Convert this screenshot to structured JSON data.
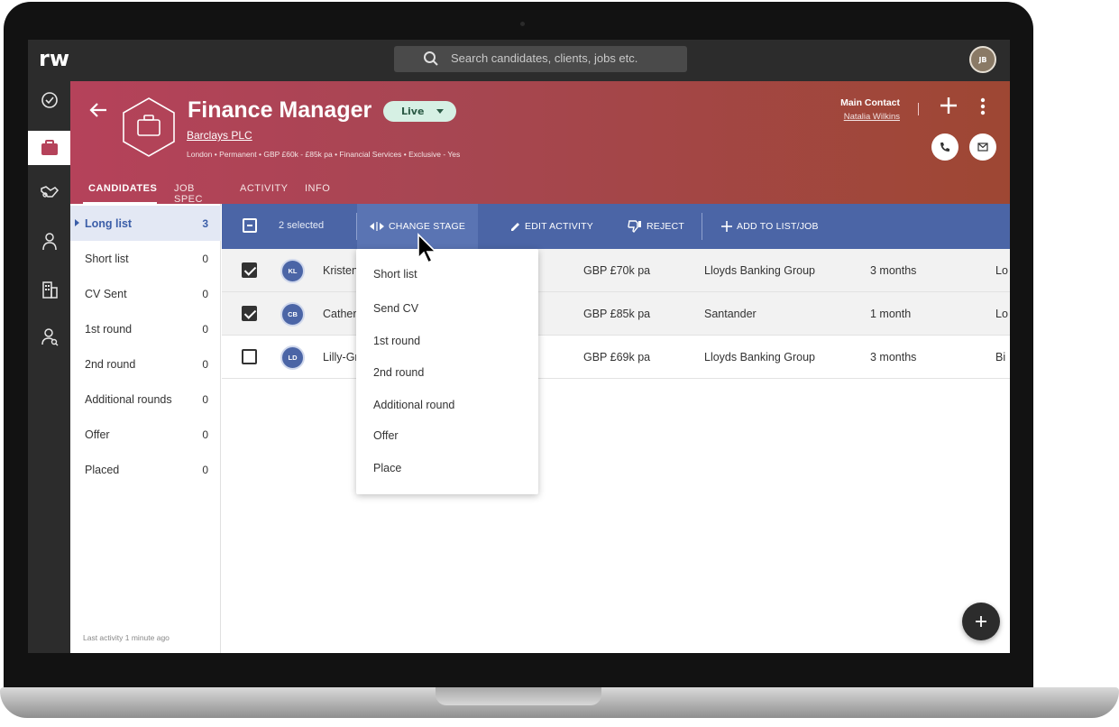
{
  "app": {
    "logo": "rw",
    "user_initials": "JB"
  },
  "search": {
    "placeholder": "Search candidates, clients, jobs etc."
  },
  "rail": {
    "icons": [
      "check-circle-icon",
      "briefcase-icon",
      "handshake-icon",
      "candidate-icon",
      "building-icon",
      "contact-search-icon"
    ],
    "active_index": 1
  },
  "job": {
    "title": "Finance Manager",
    "status": "Live",
    "company": "Barclays PLC",
    "meta": "London • Permanent • GBP £60k - £85k pa • Financial Services • Exclusive - Yes",
    "main_contact_label": "Main Contact",
    "main_contact_name": "Natalia Wilkins"
  },
  "tabs": [
    "CANDIDATES",
    "JOB SPEC",
    "ACTIVITY",
    "INFO"
  ],
  "stages": [
    {
      "label": "Long list",
      "count": "3"
    },
    {
      "label": "Short list",
      "count": "0"
    },
    {
      "label": "CV Sent",
      "count": "0"
    },
    {
      "label": "1st round",
      "count": "0"
    },
    {
      "label": "2nd round",
      "count": "0"
    },
    {
      "label": "Additional rounds",
      "count": "0"
    },
    {
      "label": "Offer",
      "count": "0"
    },
    {
      "label": "Placed",
      "count": "0"
    }
  ],
  "last_activity": "Last activity 1 minute ago",
  "actionbar": {
    "selected": "2 selected",
    "change_stage": "CHANGE STAGE",
    "edit_activity": "EDIT ACTIVITY",
    "reject": "REJECT",
    "add_to_list": "ADD TO LIST/JOB"
  },
  "rows": [
    {
      "initials": "KL",
      "name": "Kristen",
      "salary": "GBP £70k pa",
      "company": "Lloyds Banking Group",
      "notice": "3 months",
      "location": "Lo",
      "checked": true
    },
    {
      "initials": "CB",
      "name": "Cather",
      "salary": "GBP £85k pa",
      "company": "Santander",
      "notice": "1 month",
      "location": "Lo",
      "checked": true
    },
    {
      "initials": "LD",
      "name": "Lilly-Gr",
      "salary": "GBP £69k pa",
      "company": "Lloyds Banking Group",
      "notice": "3 months",
      "location": "Bi",
      "checked": false
    }
  ],
  "dropdown": [
    "Short list",
    "Send CV",
    "1st round",
    "2nd round",
    "Additional round",
    "Offer",
    "Place"
  ],
  "colors": {
    "primary": "#4b65a6",
    "header_start": "#b5425a",
    "header_end": "#9e4733",
    "dark": "#2c2c2c",
    "live": "#d6f0e4"
  }
}
